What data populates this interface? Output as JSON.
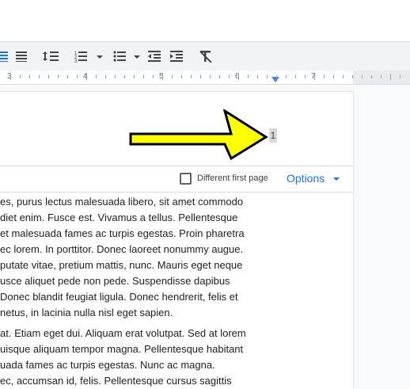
{
  "page_number": "1",
  "header_bar": {
    "checkbox_label": "Different first page",
    "options_label": "Options"
  },
  "ruler": {
    "numbers": [
      "3",
      "4",
      "5",
      "6",
      "7"
    ]
  },
  "toolbar": {
    "icons": [
      "align-justify-icon",
      "align-justify-icon-2",
      "line-spacing-icon",
      "numbered-list-icon",
      "bulleted-list-icon",
      "decrease-indent-icon",
      "increase-indent-icon",
      "clear-formatting-icon"
    ]
  },
  "body": {
    "paragraph1": [
      "es, purus lectus malesuada libero, sit amet commodo",
      "diet enim. Fusce est. Vivamus a tellus. Pellentesque",
      "et malesuada fames ac turpis egestas. Proin pharetra",
      "ec lorem. In porttitor. Donec laoreet nonummy augue.",
      "putate vitae, pretium mattis, nunc. Mauris eget neque",
      "usce aliquet pede non pede. Suspendisse dapibus",
      "Donec blandit feugiat ligula. Donec hendrerit, felis et",
      "netus, in lacinia nulla nisl eget sapien."
    ],
    "paragraph2": [
      "at. Etiam eget dui. Aliquam erat volutpat. Sed at lorem",
      "uisque aliquam tempor magna. Pellentesque habitant",
      "uada fames ac turpis egestas. Nunc ac magna.",
      "ec, accumsan id, felis. Pellentesque cursus sagittis"
    ]
  },
  "colors": {
    "arrow_fill": "#ffff00",
    "accent": "#1a73e8",
    "indent_marker": "#4285f4"
  }
}
